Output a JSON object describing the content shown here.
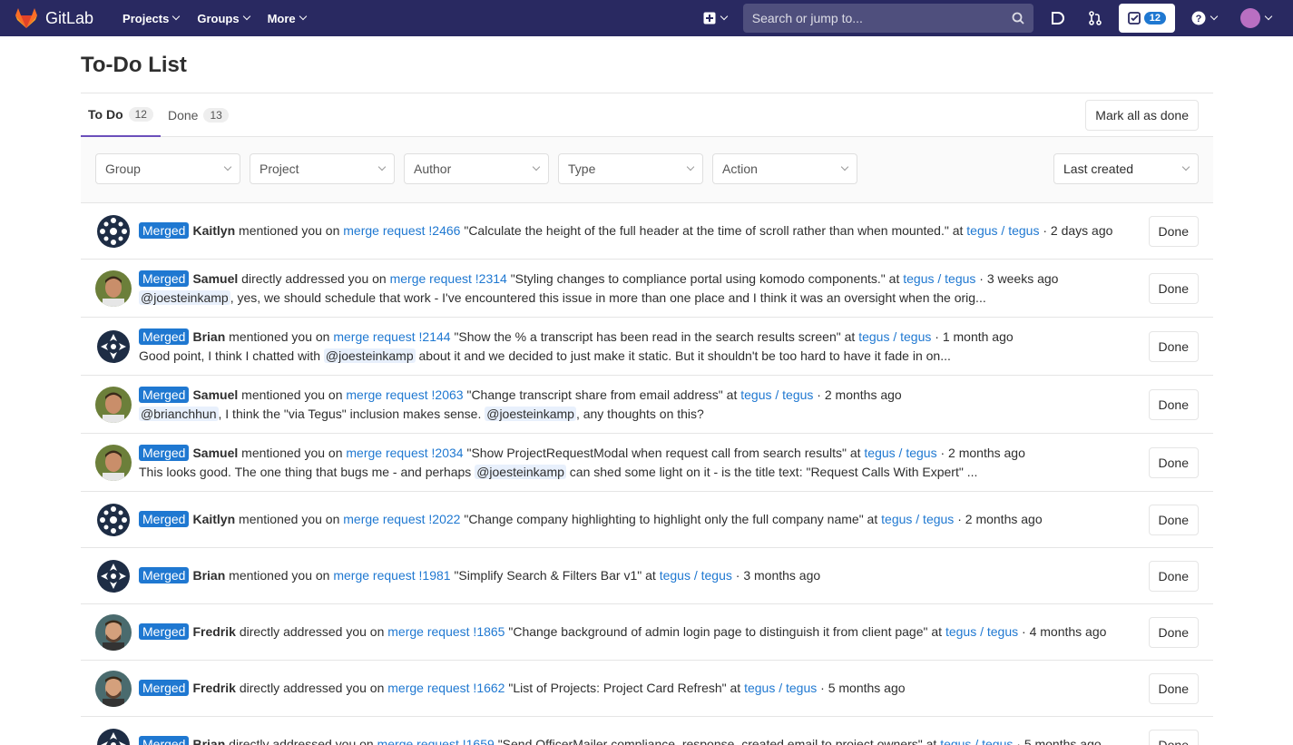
{
  "nav": {
    "brand": "GitLab",
    "menu": [
      "Projects",
      "Groups",
      "More"
    ],
    "search_placeholder": "Search or jump to...",
    "todo_count": "12"
  },
  "page": {
    "title": "To-Do List",
    "tabs": [
      {
        "label": "To Do",
        "count": "12"
      },
      {
        "label": "Done",
        "count": "13"
      }
    ],
    "mark_all_label": "Mark all as done",
    "filters": [
      "Group",
      "Project",
      "Author",
      "Type",
      "Action"
    ],
    "sort_label": "Last created",
    "done_label": "Done",
    "merged_label": "Merged"
  },
  "todos": [
    {
      "author": "Kaitlyn",
      "action": "mentioned you on",
      "mr": "merge request !2466",
      "title": "\"Calculate the height of the full header at the time of scroll rather than when mounted.\"",
      "project": "tegus / tegus",
      "time": "2 days ago",
      "note": ""
    },
    {
      "author": "Samuel",
      "action": "directly addressed you on",
      "mr": "merge request !2314",
      "title": "\"Styling changes to compliance portal using komodo components.\"",
      "project": "tegus / tegus",
      "time": "3 weeks ago",
      "note_mention": "@joesteinkamp",
      "note": ", yes, we should schedule that work - I've encountered this issue in more than one place and I think it was an oversight when the orig..."
    },
    {
      "author": "Brian",
      "action": "mentioned you on",
      "mr": "merge request !2144",
      "title": "\"Show the % a transcript has been read in the search results screen\"",
      "project": "tegus / tegus",
      "time": "1 month ago",
      "note_pre": "Good point, I think I chatted with ",
      "note_mention": "@joesteinkamp",
      "note": " about it and we decided to just make it static. But it shouldn't be too hard to have it fade in on..."
    },
    {
      "author": "Samuel",
      "action": "mentioned you on",
      "mr": "merge request !2063",
      "title": "\"Change transcript share from email address\"",
      "project": "tegus / tegus",
      "time": "2 months ago",
      "note_mention": "@brianchhun",
      "note_mid": ", I think the \"via Tegus\" inclusion makes sense. ",
      "note_mention2": "@joesteinkamp",
      "note": ", any thoughts on this?"
    },
    {
      "author": "Samuel",
      "action": "mentioned you on",
      "mr": "merge request !2034",
      "title": "\"Show ProjectRequestModal when request call from search results\"",
      "project": "tegus / tegus",
      "time": "2 months ago",
      "note_pre": "This looks good. The one thing that bugs me - and perhaps ",
      "note_mention": "@joesteinkamp",
      "note": " can shed some light on it - is the title text: \"Request Calls With Expert\" ..."
    },
    {
      "author": "Kaitlyn",
      "action": "mentioned you on",
      "mr": "merge request !2022",
      "title": "\"Change company highlighting to highlight only the full company name\"",
      "project": "tegus / tegus",
      "time": "2 months ago",
      "note": ""
    },
    {
      "author": "Brian",
      "action": "mentioned you on",
      "mr": "merge request !1981",
      "title": "\"Simplify Search & Filters Bar v1\"",
      "project": "tegus / tegus",
      "time": "3 months ago",
      "note": ""
    },
    {
      "author": "Fredrik",
      "action": "directly addressed you on",
      "mr": "merge request !1865",
      "title": "\"Change background of admin login page to distinguish it from client page\"",
      "project": "tegus / tegus",
      "time": "4 months ago",
      "note": ""
    },
    {
      "author": "Fredrik",
      "action": "directly addressed you on",
      "mr": "merge request !1662",
      "title": "\"List of Projects: Project Card Refresh\"",
      "project": "tegus / tegus",
      "time": "5 months ago",
      "note": ""
    },
    {
      "author": "Brian",
      "action": "directly addressed you on",
      "mr": "merge request !1659",
      "title": "\"Send OfficerMailer compliance_response_created email to project owners\"",
      "project": "tegus / tegus",
      "time": "5 months ago",
      "note": ""
    }
  ]
}
